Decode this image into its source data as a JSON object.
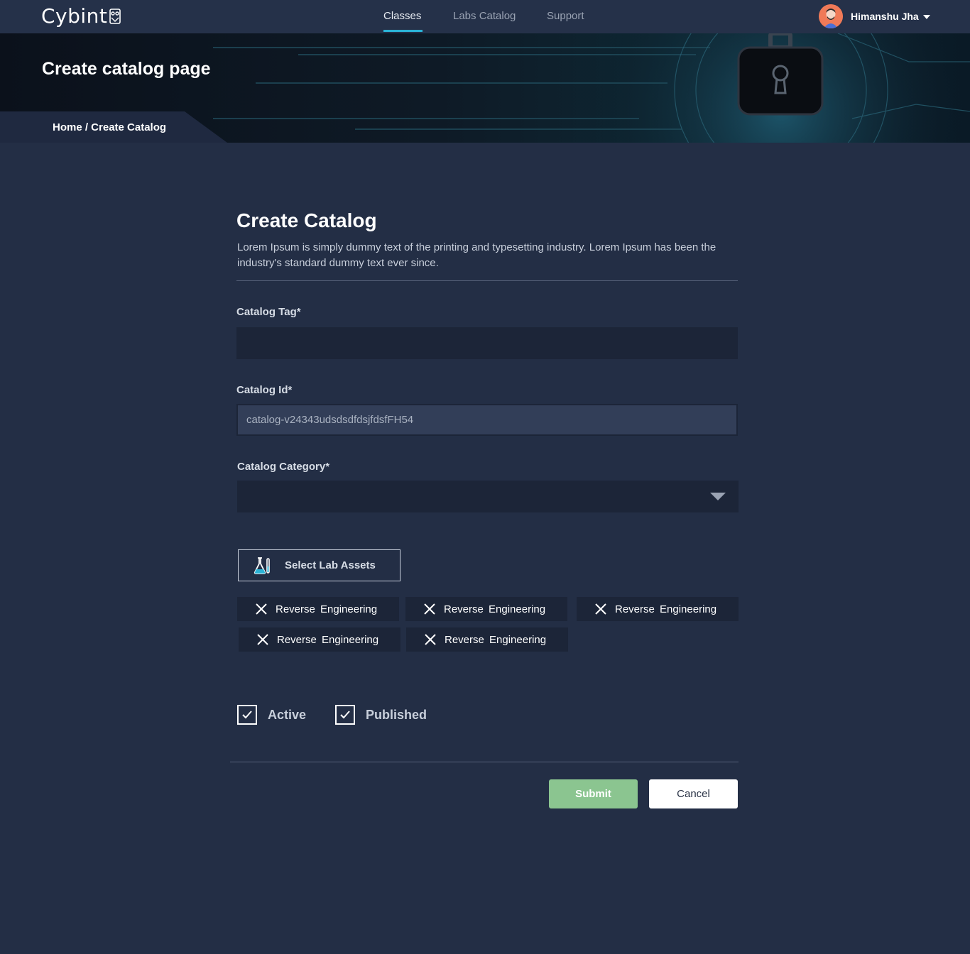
{
  "brand": {
    "name": "Cybint"
  },
  "nav": {
    "links": [
      "Classes",
      "Labs Catalog",
      "Support"
    ],
    "active": "Classes"
  },
  "user": {
    "name": "Himanshu Jha"
  },
  "banner": {
    "title": "Create catalog page",
    "breadcrumb": "Home / Create Catalog"
  },
  "form": {
    "title": "Create Catalog",
    "description": "Lorem Ipsum is simply dummy text of the printing and typesetting industry. Lorem Ipsum has been the industry's standard dummy text ever since.",
    "catalog_tag": {
      "label": "Catalog Tag*",
      "value": ""
    },
    "catalog_id": {
      "label": "Catalog Id*",
      "value": "catalog-v24343udsdsdfdsjfdsfFH54"
    },
    "catalog_category": {
      "label": "Catalog Category*",
      "value": ""
    },
    "select_assets_label": "Select Lab Assets",
    "chips": [
      "Reverse Engineering",
      "Reverse Engineering",
      "Reverse Engineering",
      "Reverse Engineering",
      "Reverse Engineering"
    ],
    "checkboxes": [
      {
        "label": "Active",
        "checked": true
      },
      {
        "label": "Published",
        "checked": true
      }
    ],
    "submit_label": "Submit",
    "cancel_label": "Cancel"
  },
  "colors": {
    "page_bg": "#232e45",
    "nav_bg": "#253149",
    "accent": "#2bb3d6",
    "submit": "#8bc590",
    "input_bg": "#1c2538"
  },
  "icons": [
    "owl-logo-icon",
    "avatar-icon",
    "chevron-down-icon",
    "lock-icon",
    "flask-icon",
    "close-icon",
    "checkmark-icon"
  ]
}
